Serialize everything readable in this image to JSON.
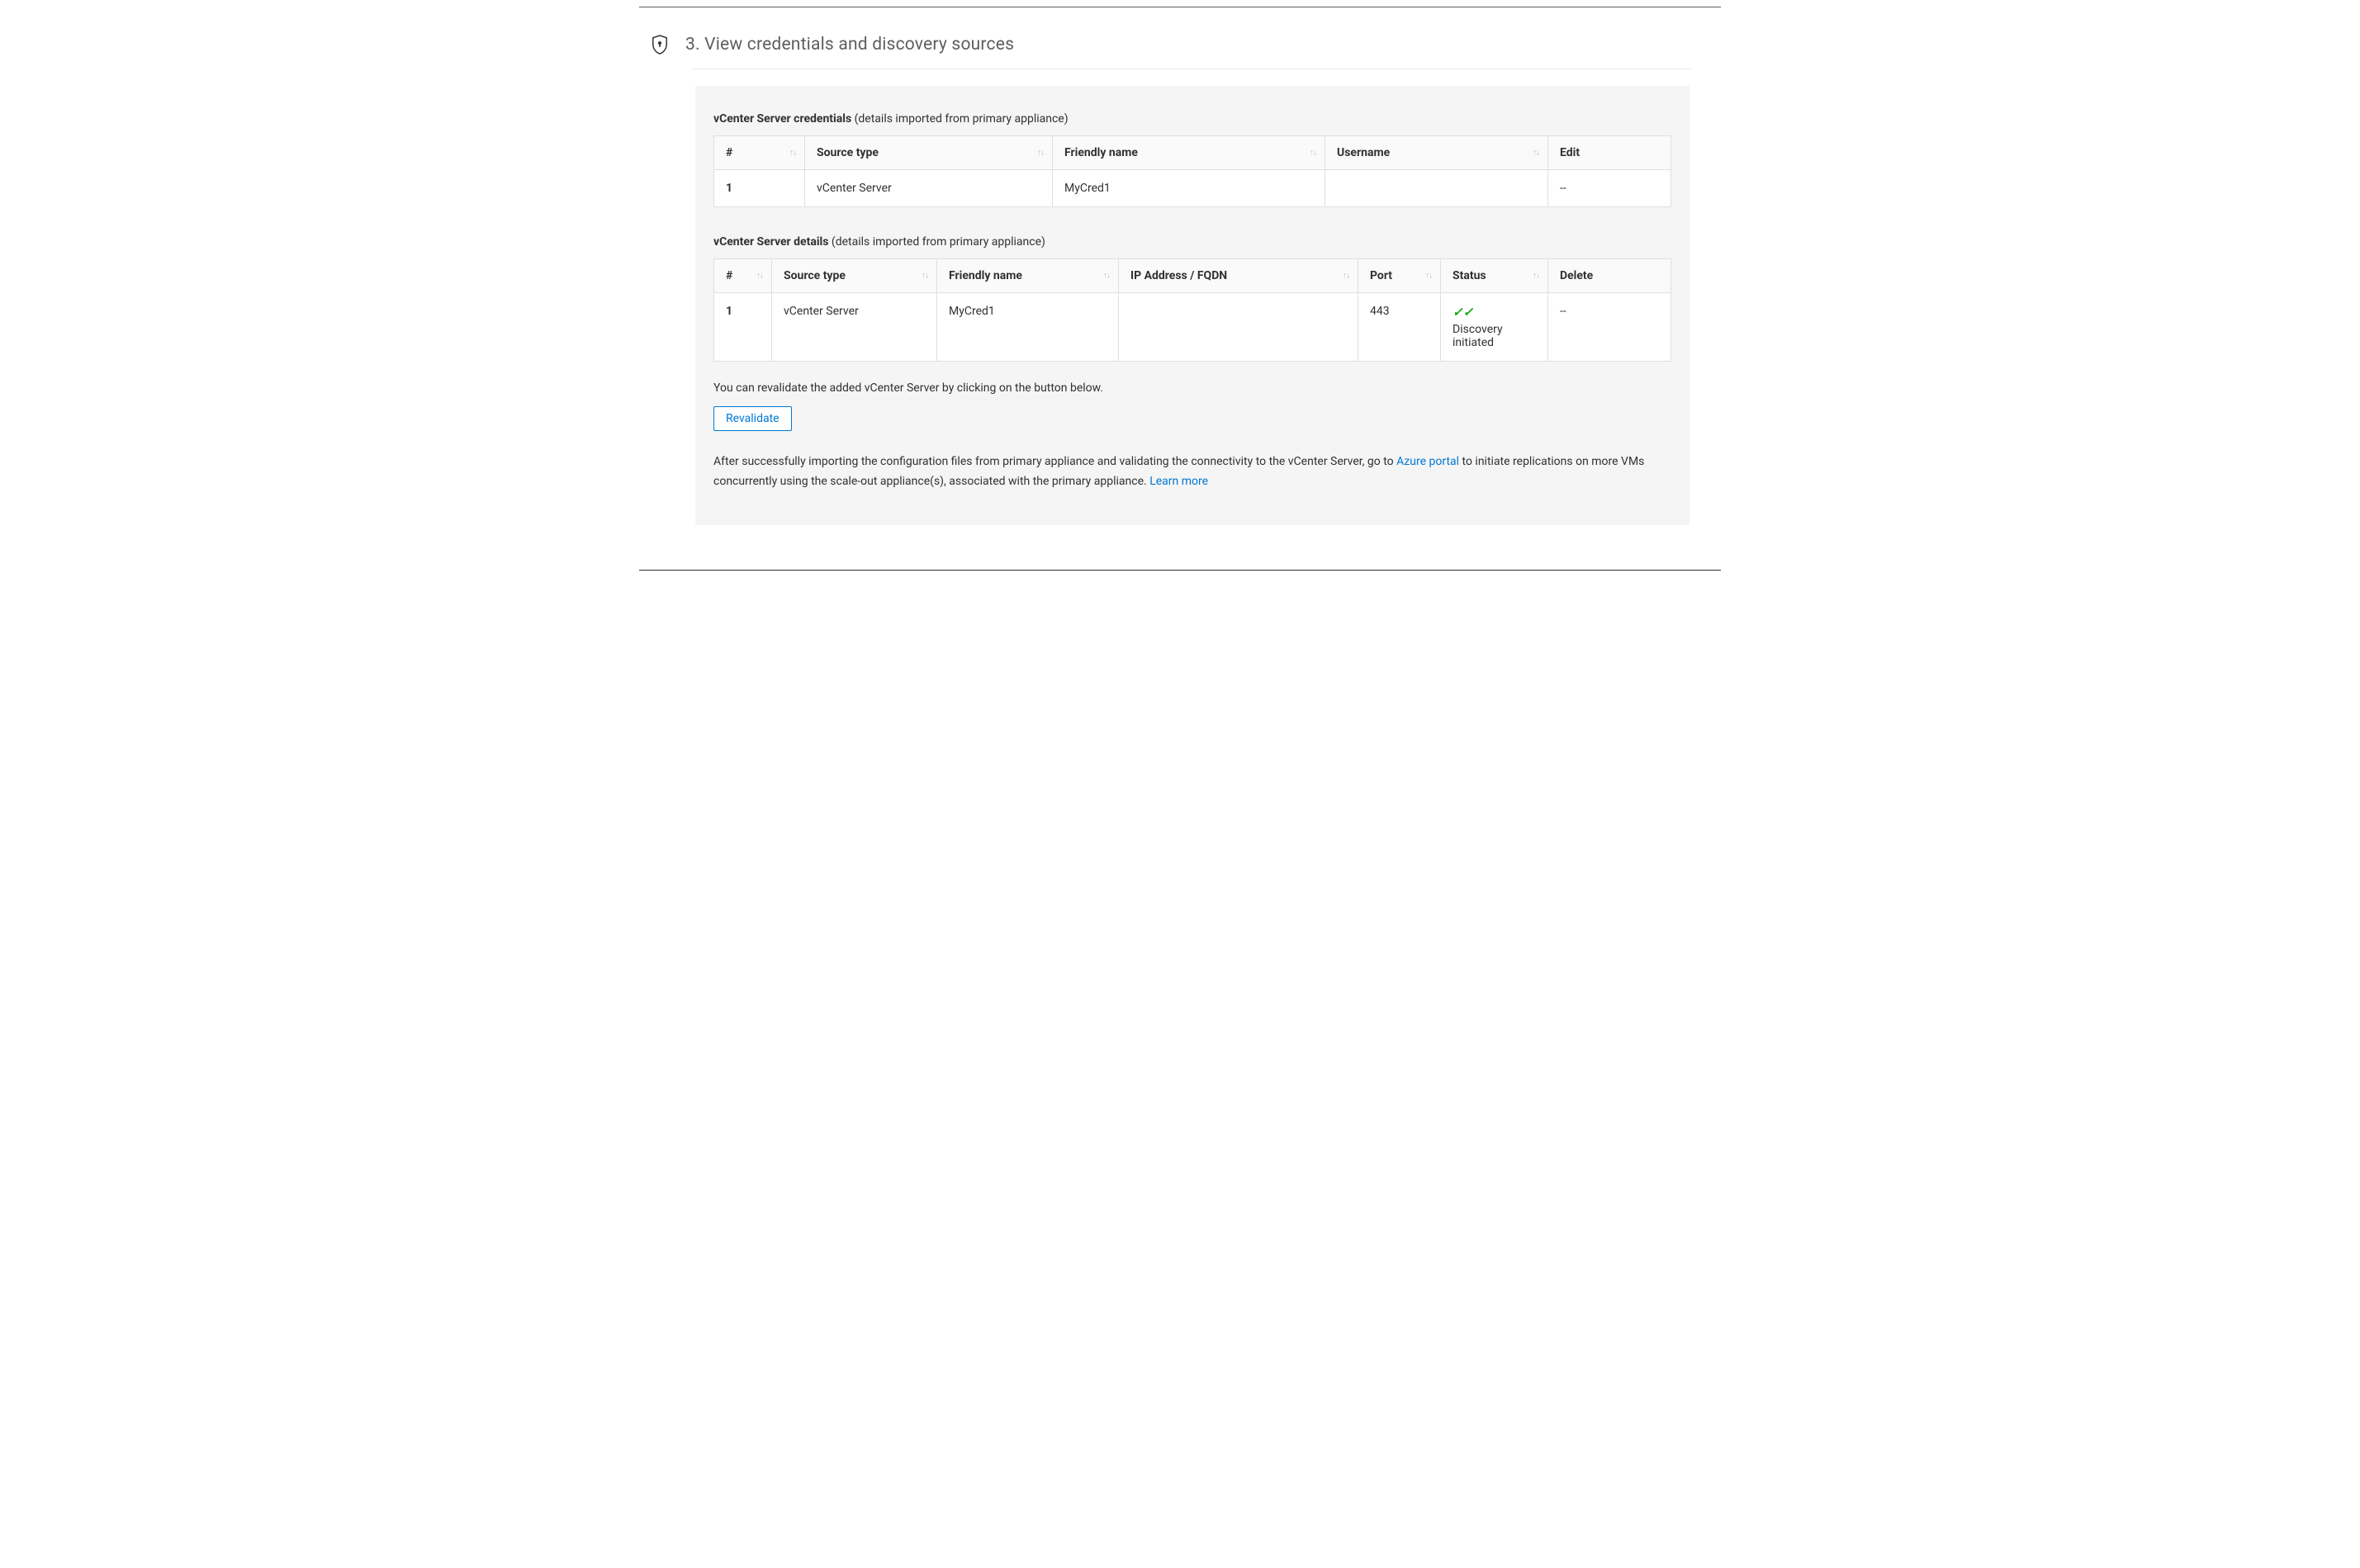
{
  "section": {
    "title": "3. View credentials and discovery sources"
  },
  "credentials": {
    "label_bold": "vCenter Server credentials",
    "label_rest": " (details imported from primary appliance)",
    "columns": {
      "index": "#",
      "source_type": "Source type",
      "friendly_name": "Friendly name",
      "username": "Username",
      "edit": "Edit"
    },
    "rows": [
      {
        "index": "1",
        "source_type": "vCenter Server",
        "friendly_name": "MyCred1",
        "username": "",
        "edit": "--"
      }
    ]
  },
  "details": {
    "label_bold": "vCenter Server details",
    "label_rest": " (details imported from primary appliance)",
    "columns": {
      "index": "#",
      "source_type": "Source type",
      "friendly_name": "Friendly name",
      "ip_fqdn": "IP Address / FQDN",
      "port": "Port",
      "status": "Status",
      "delete": "Delete"
    },
    "rows": [
      {
        "index": "1",
        "source_type": "vCenter Server",
        "friendly_name": "MyCred1",
        "ip_fqdn": "",
        "port": "443",
        "status_text": "Discovery initiated",
        "delete": "--"
      }
    ]
  },
  "revalidate": {
    "note": "You can revalidate the added vCenter Server by clicking on the button below.",
    "button": "Revalidate"
  },
  "after": {
    "pre": "After successfully importing the configuration files from primary appliance and validating the connectivity to the vCenter Server, go to ",
    "link1": "Azure portal",
    "mid": " to initiate replications on more VMs concurrently using the scale-out appliance(s), associated with the primary appliance. ",
    "link2": "Learn more"
  },
  "sort_glyph": "↑↓"
}
